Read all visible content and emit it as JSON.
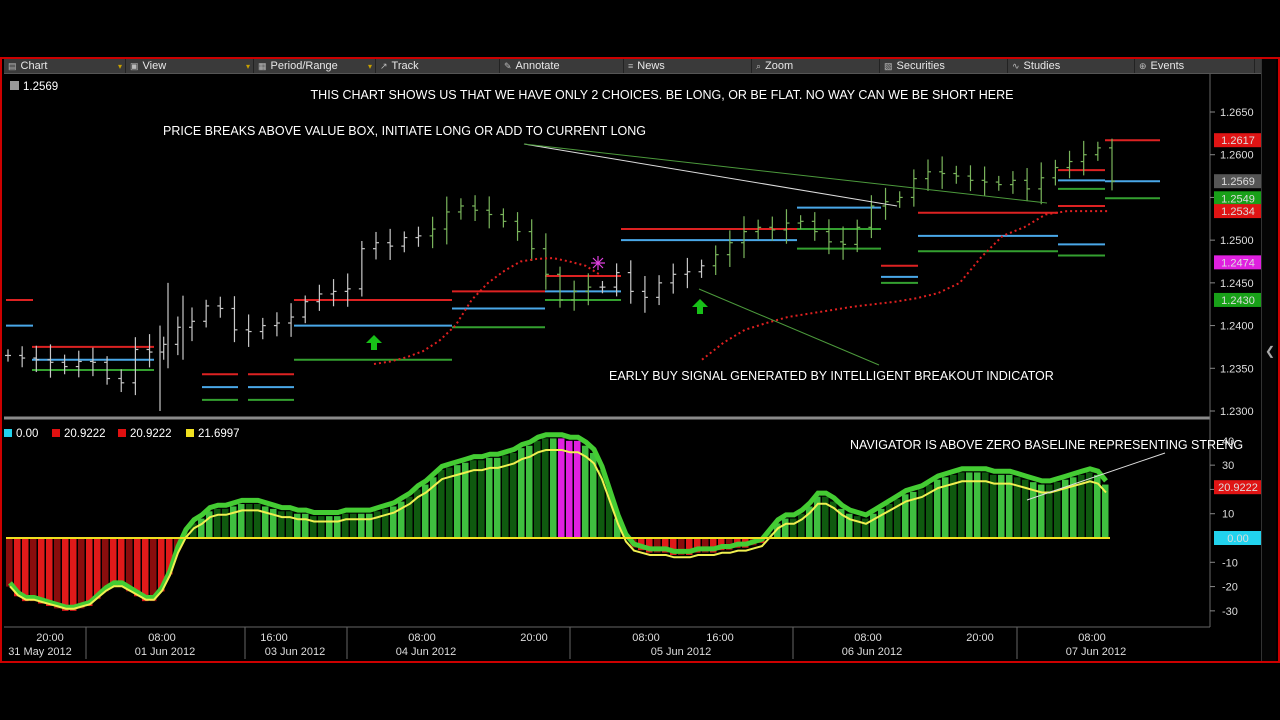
{
  "toolbar": {
    "items": [
      {
        "label": "Chart",
        "icon": "chart-icon"
      },
      {
        "label": "View",
        "icon": "view-icon"
      },
      {
        "label": "Period/Range",
        "icon": "period-icon"
      },
      {
        "label": "Track",
        "icon": "track-icon"
      },
      {
        "label": "Annotate",
        "icon": "annotate-icon"
      },
      {
        "label": "News",
        "icon": "news-icon"
      },
      {
        "label": "Zoom",
        "icon": "zoom-icon"
      },
      {
        "label": "Securities",
        "icon": "securities-icon"
      },
      {
        "label": "Studies",
        "icon": "studies-icon"
      },
      {
        "label": "Events",
        "icon": "events-icon"
      }
    ]
  },
  "price_legend": {
    "value": "1.2569",
    "color": "#999999"
  },
  "annotations": {
    "top": "THIS CHART SHOWS US THAT WE HAVE ONLY 2 CHOICES. BE LONG, OR BE FLAT. NO WAY CAN WE BE SHORT HERE",
    "breakout": "PRICE BREAKS ABOVE VALUE BOX, INITIATE LONG OR ADD TO CURRENT LONG",
    "early_buy": "EARLY BUY SIGNAL GENERATED BY INTELLIGENT BREAKOUT INDICATOR",
    "navigator": "NAVIGATOR IS ABOVE ZERO BASELINE REPRESENTING STRENG"
  },
  "osc_legend": [
    {
      "value": "0.00",
      "color": "#22d3ee"
    },
    {
      "value": "20.9222",
      "color": "#e01010"
    },
    {
      "value": "20.9222",
      "color": "#e01010"
    },
    {
      "value": "21.6997",
      "color": "#f0e020"
    }
  ],
  "chart_data": [
    {
      "type": "ohlc",
      "ylim": [
        1.2295,
        1.2668
      ],
      "yticks": [
        1.23,
        1.235,
        1.24,
        1.245,
        1.25,
        1.255,
        1.26,
        1.265
      ],
      "ytick_labels": [
        "1.2300",
        "1.2350",
        "1.2400",
        "1.2450",
        "1.2500",
        "1.2550",
        "1.2600",
        "1.2650"
      ],
      "close_path": [
        1.2365,
        1.2362,
        1.236,
        1.2357,
        1.2352,
        1.2358,
        1.2357,
        1.2338,
        1.2333,
        1.2372,
        1.2369,
        1.2378,
        1.2398,
        1.2405,
        1.2423,
        1.242,
        1.2395,
        1.2393,
        1.24,
        1.2403,
        1.241,
        1.2428,
        1.2437,
        1.244,
        1.2443,
        1.249,
        1.2497,
        1.2493,
        1.2503,
        1.2505,
        1.2513,
        1.2533,
        1.254,
        1.2535,
        1.253,
        1.2522,
        1.251,
        1.249,
        1.246,
        1.243,
        1.244,
        1.2445,
        1.2445,
        1.2462,
        1.244,
        1.2433,
        1.245,
        1.246,
        1.2463,
        1.247,
        1.2483,
        1.2497,
        1.251,
        1.2515,
        1.2512,
        1.252,
        1.2522,
        1.251,
        1.2498,
        1.2495,
        1.2515,
        1.254,
        1.2545,
        1.255,
        1.2572,
        1.258,
        1.2578,
        1.2575,
        1.257,
        1.2568,
        1.2565,
        1.257,
        1.256,
        1.2573,
        1.2585,
        1.2592,
        1.26,
        1.2608,
        1.2569
      ],
      "levels": [
        {
          "y": 1.243,
          "color": "#dd2222"
        },
        {
          "y": 1.24,
          "color": "#4aa8e8"
        },
        {
          "y": 1.236,
          "color": "#34a030"
        },
        {
          "y": 1.2375,
          "color": "#dd2222"
        },
        {
          "y": 1.236,
          "color": "#4aa8e8"
        },
        {
          "y": 1.2348,
          "color": "#34a030"
        },
        {
          "y": 1.2343,
          "color": "#dd2222"
        },
        {
          "y": 1.2328,
          "color": "#4aa8e8"
        },
        {
          "y": 1.2313,
          "color": "#34a030"
        },
        {
          "y": 1.244,
          "color": "#dd2222"
        },
        {
          "y": 1.242,
          "color": "#4aa8e8"
        },
        {
          "y": 1.2398,
          "color": "#34a030"
        },
        {
          "y": 1.2458,
          "color": "#dd2222"
        },
        {
          "y": 1.244,
          "color": "#4aa8e8"
        },
        {
          "y": 1.243,
          "color": "#34a030"
        },
        {
          "y": 1.2513,
          "color": "#dd2222"
        },
        {
          "y": 1.25,
          "color": "#4aa8e8"
        },
        {
          "y": 1.249,
          "color": "#34a030"
        },
        {
          "y": 1.2538,
          "color": "#4aa8e8"
        },
        {
          "y": 1.2513,
          "color": "#34a030"
        },
        {
          "y": 1.247,
          "color": "#dd2222"
        },
        {
          "y": 1.2457,
          "color": "#4aa8e8"
        },
        {
          "y": 1.245,
          "color": "#34a030"
        },
        {
          "y": 1.2532,
          "color": "#dd2222"
        },
        {
          "y": 1.2505,
          "color": "#4aa8e8"
        },
        {
          "y": 1.2487,
          "color": "#34a030"
        },
        {
          "y": 1.254,
          "color": "#dd2222"
        },
        {
          "y": 1.2495,
          "color": "#4aa8e8"
        },
        {
          "y": 1.2482,
          "color": "#34a030"
        },
        {
          "y": 1.2582,
          "color": "#dd2222"
        },
        {
          "y": 1.257,
          "color": "#4aa8e8"
        },
        {
          "y": 1.256,
          "color": "#34a030"
        },
        {
          "y": 1.2617,
          "color": "#dd2222"
        },
        {
          "y": 1.2569,
          "color": "#4aa8e8"
        },
        {
          "y": 1.2549,
          "color": "#34a030"
        }
      ],
      "trailing_stop": [
        1.2355,
        1.2358,
        1.2363,
        1.237,
        1.2382,
        1.24,
        1.243,
        1.245,
        1.2464,
        1.2475,
        1.2478,
        1.2479,
        1.2475,
        1.247,
        1.2458
      ],
      "trailing_stop_2": [
        1.236,
        1.238,
        1.2395,
        1.2403,
        1.241,
        1.2414,
        1.2418,
        1.2422,
        1.2425,
        1.2428,
        1.2432,
        1.2438,
        1.245,
        1.248,
        1.2505,
        1.2515,
        1.253,
        1.2534,
        1.2534,
        1.2534
      ],
      "price_labels": [
        {
          "value": "1.2617",
          "color": "#e01414"
        },
        {
          "value": "1.2569",
          "color": "#555555"
        },
        {
          "value": "1.2549",
          "color": "#18a018"
        },
        {
          "value": "1.2534",
          "color": "#e01414"
        },
        {
          "value": "1.2474",
          "color": "#e020e0"
        },
        {
          "value": "1.2430",
          "color": "#18a018"
        }
      ]
    },
    {
      "type": "histogram",
      "name": "Navigator",
      "ylim": [
        -37,
        44
      ],
      "yticks": [
        40,
        30,
        20,
        10,
        -10,
        -20,
        -30
      ],
      "ytick_labels": [
        "40",
        "30",
        "20",
        "10",
        "-10",
        "-20",
        "-30"
      ],
      "values": [
        -20,
        -24,
        -26,
        -26,
        -27,
        -28,
        -29,
        -30,
        -30,
        -29,
        -28,
        -25,
        -22,
        -20,
        -20,
        -22,
        -24,
        -26,
        -26,
        -22,
        -15,
        -5,
        2,
        6,
        8,
        11,
        12,
        12,
        13,
        14,
        14,
        14,
        13,
        12,
        11,
        11,
        10,
        10,
        9,
        9,
        9,
        9,
        10,
        10,
        10,
        10,
        11,
        12,
        13,
        15,
        17,
        20,
        22,
        25,
        28,
        29,
        30,
        31,
        32,
        32,
        33,
        33,
        34,
        35,
        37,
        38,
        40,
        41,
        41,
        41,
        40,
        40,
        38,
        35,
        28,
        18,
        8,
        0,
        -4,
        -5,
        -6,
        -6,
        -6,
        -7,
        -7,
        -7,
        -6,
        -6,
        -6,
        -5,
        -5,
        -4,
        -4,
        -3,
        -2,
        2,
        6,
        8,
        8,
        10,
        13,
        17,
        17,
        15,
        12,
        10,
        9,
        8,
        10,
        12,
        14,
        16,
        18,
        19,
        20,
        22,
        24,
        25,
        26,
        27,
        27,
        27,
        27,
        26,
        26,
        26,
        25,
        24,
        23,
        22,
        22,
        23,
        24,
        25,
        26,
        27,
        26,
        22
      ],
      "current_value": "20.9222",
      "zero_label": "0.00"
    }
  ],
  "x_axis": {
    "time_labels": [
      "20:00",
      "08:00",
      "16:00",
      "08:00",
      "20:00",
      "08:00",
      "16:00",
      "08:00",
      "20:00",
      "08:00"
    ],
    "date_labels": [
      "31 May 2012",
      "01 Jun 2012",
      "03 Jun 2012",
      "04 Jun 2012",
      "05 Jun 2012",
      "06 Jun 2012",
      "07 Jun 2012"
    ]
  }
}
